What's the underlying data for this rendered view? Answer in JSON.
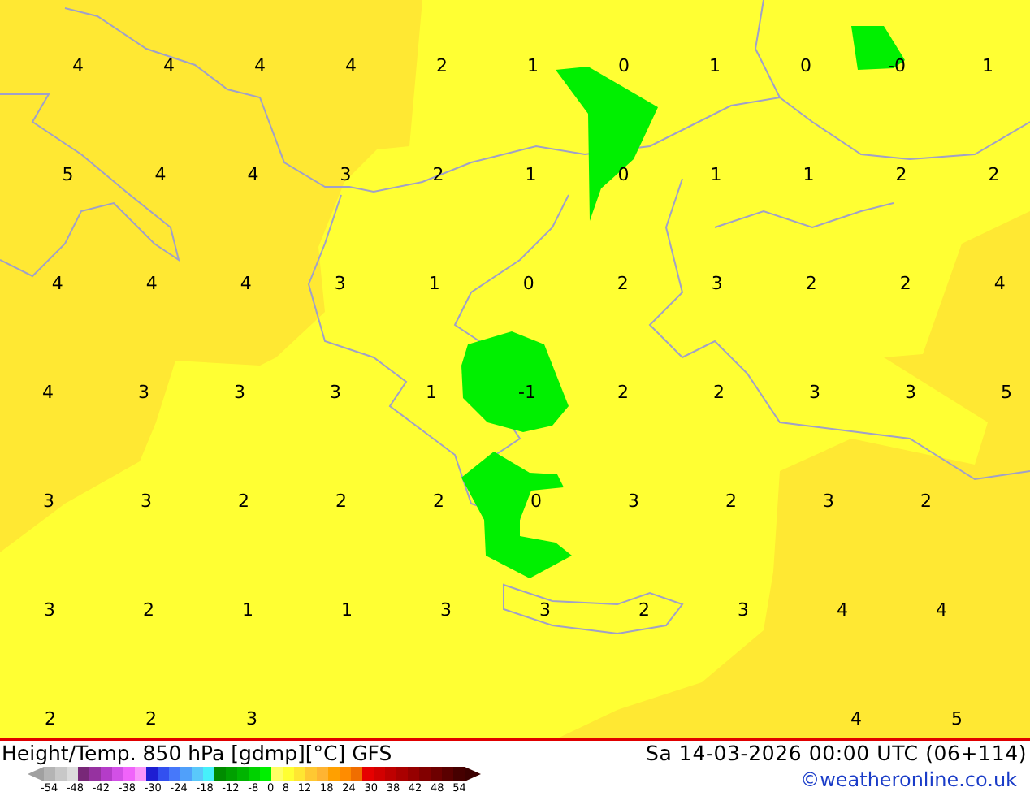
{
  "map": {
    "value_rows": [
      [
        "4",
        "4",
        "4",
        "4",
        "2",
        "1",
        "0",
        "1",
        "0",
        "-0",
        "1"
      ],
      [
        "5",
        "4",
        "4",
        "3",
        "2",
        "1",
        "0",
        "1",
        "1",
        "2",
        "2"
      ],
      [
        "4",
        "4",
        "4",
        "3",
        "1",
        "0",
        "2",
        "3",
        "2",
        "2",
        "4"
      ],
      [
        "4",
        "3",
        "3",
        "3",
        "1",
        "-1",
        "2",
        "2",
        "3",
        "3",
        "5"
      ],
      [
        "3",
        "3",
        "2",
        "2",
        "2",
        "0",
        "3",
        "2",
        "3",
        "2",
        null
      ],
      [
        "3",
        "2",
        "1",
        "1",
        "3",
        "3",
        "2",
        "3",
        "4",
        "4"
      ],
      [
        "2",
        "2",
        "3",
        null,
        null,
        null,
        null,
        null,
        "4",
        "5"
      ]
    ]
  },
  "footer": {
    "title": "Height/Temp. 850 hPa [gdmp][°C] GFS",
    "datetime": "Sa 14-03-2026 00:00 UTC (06+114)",
    "credit": "©weatheronline.co.uk"
  },
  "legend": {
    "colors": [
      {
        "color": "#a0a0a0"
      },
      {
        "color": "#b4b4b4"
      },
      {
        "color": "#c8c8c8"
      },
      {
        "color": "#dcdcdc"
      },
      {
        "color": "#782878"
      },
      {
        "color": "#9632a0"
      },
      {
        "color": "#b43cc8"
      },
      {
        "color": "#d250e6"
      },
      {
        "color": "#f064fa"
      },
      {
        "color": "#fa96fa"
      },
      {
        "color": "#1e1ed2"
      },
      {
        "color": "#3250f0"
      },
      {
        "color": "#4678fa"
      },
      {
        "color": "#50a0fa"
      },
      {
        "color": "#5ac8fa"
      },
      {
        "color": "#46f0fa"
      },
      {
        "color": "#008c00"
      },
      {
        "color": "#00a000"
      },
      {
        "color": "#00b400"
      },
      {
        "color": "#00d200"
      },
      {
        "color": "#00f000"
      },
      {
        "color": "#ffff64"
      },
      {
        "color": "#ffff32"
      },
      {
        "color": "#ffe632"
      },
      {
        "color": "#ffc832"
      },
      {
        "color": "#ffb432"
      },
      {
        "color": "#ffa000"
      },
      {
        "color": "#ff8c00"
      },
      {
        "color": "#f06e00"
      },
      {
        "color": "#e60000"
      },
      {
        "color": "#d20000"
      },
      {
        "color": "#be0000"
      },
      {
        "color": "#aa0000"
      },
      {
        "color": "#960000"
      },
      {
        "color": "#820000"
      },
      {
        "color": "#6e0000"
      },
      {
        "color": "#5a0000"
      },
      {
        "color": "#460000"
      },
      {
        "color": "#3c0000"
      }
    ],
    "ticks": [
      "-54",
      "-48",
      "-42",
      "-38",
      "-30",
      "-24",
      "-18",
      "-12",
      "-8",
      "0",
      "8",
      "12",
      "18",
      "24",
      "30",
      "38",
      "42",
      "48",
      "54"
    ]
  }
}
